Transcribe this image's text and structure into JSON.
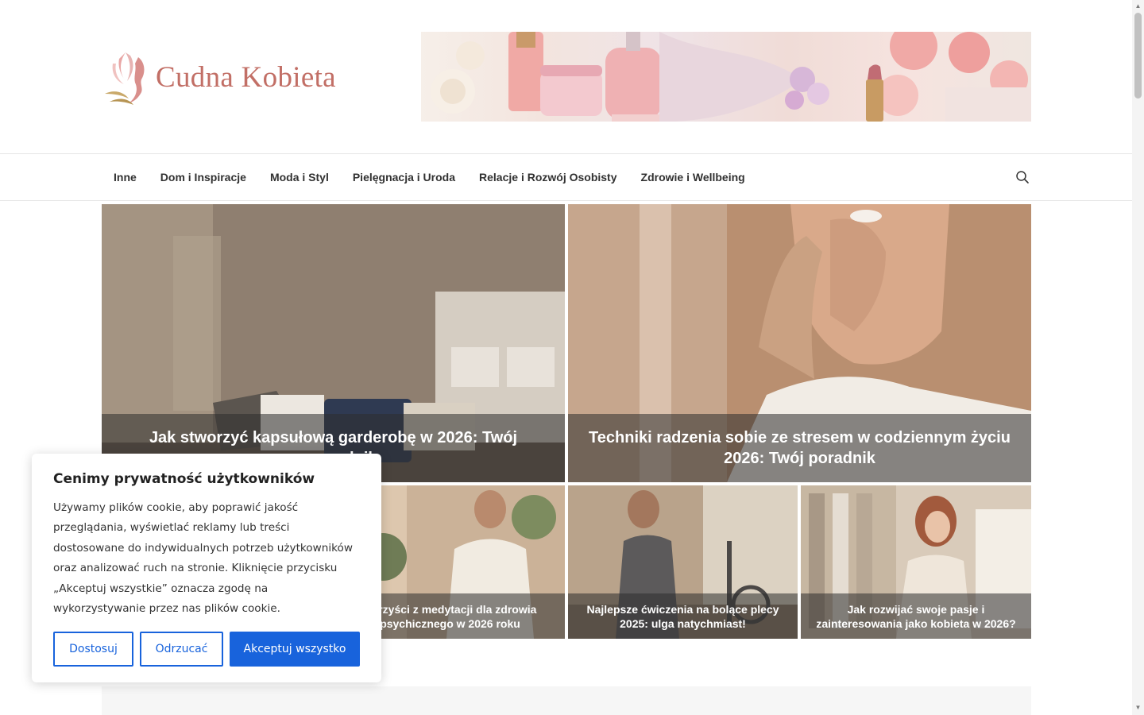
{
  "site": {
    "logo_text": "Cudna Kobieta"
  },
  "nav": {
    "items": [
      "Inne",
      "Dom i Inspiracje",
      "Moda i Styl",
      "Pielęgnacja i Uroda",
      "Relacje i Rozwój Osobisty",
      "Zdrowie i Wellbeing"
    ],
    "search_icon": "search-icon"
  },
  "featured": [
    {
      "title": "Jak stworzyć kapsułową garderobę w 2026: Twój przewodnik"
    },
    {
      "title": "Techniki radzenia sobie ze stresem w codziennym życiu 2026: Twój poradnik"
    },
    {
      "title": "Korzyści z medytacji dla zdrowia psychicznego w 2026 roku"
    },
    {
      "title": "Najlepsze ćwiczenia na bolące plecy 2025: ulga natychmiast!"
    },
    {
      "title": "Jak rozwijać swoje pasje i zainteresowania jako kobieta w 2026?"
    }
  ],
  "cookie": {
    "title": "Cenimy prywatność użytkowników",
    "text": "Używamy plików cookie, aby poprawić jakość przeglądania, wyświetlać reklamy lub treści dostosowane do indywidualnych potrzeb użytkowników oraz analizować ruch na stronie. Kliknięcie przycisku „Akceptuj wszystkie” oznacza zgodę na wykorzystywanie przez nas plików cookie.",
    "customize_label": "Dostosuj",
    "reject_label": "Odrzucać",
    "accept_label": "Akceptuj wszystko"
  },
  "colors": {
    "accent": "#1863dc",
    "logo": "#c26f66"
  }
}
